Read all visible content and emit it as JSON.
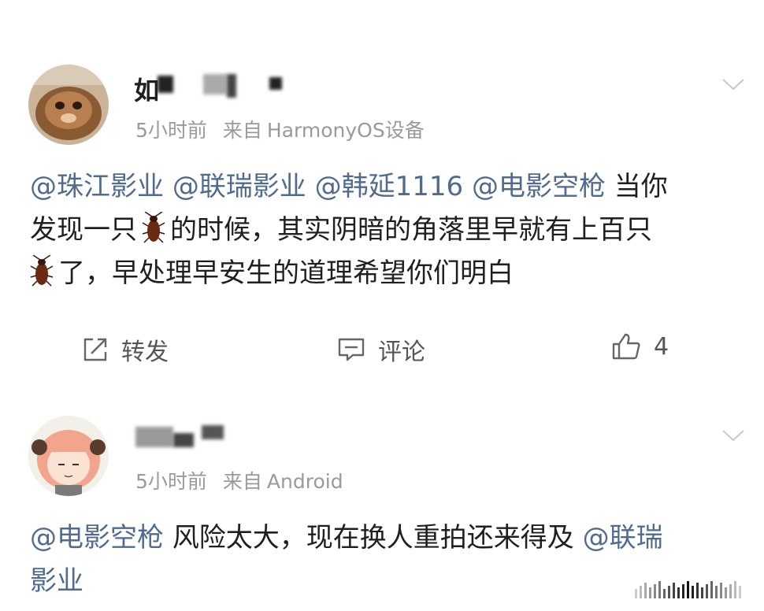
{
  "posts": [
    {
      "username_partial": "如",
      "time": "5小时前",
      "source_prefix": "来自",
      "source": "HarmonyOS设备",
      "mentions": [
        "@珠江影业",
        "@联瑞影业",
        "@韩延1116",
        "@电影空枪"
      ],
      "text_1": "当你",
      "text_2": "发现一只",
      "text_3": "的时候，其实阴暗的角落里早就有上百只",
      "text_4": "了，早处理早安生的道理希望你们明白",
      "actions": {
        "repost": "转发",
        "comment": "评论",
        "like_count": "4"
      }
    },
    {
      "time": "5小时前",
      "source_prefix": "来自",
      "source": "Android",
      "mention_1": "@电影空枪",
      "text_1": "风险太大，现在换人重拍还来得及",
      "mention_2": "@联瑞",
      "mention_2_cont": "影业"
    }
  ],
  "colors": {
    "mention": "#506b8e",
    "meta": "#9a9a9a",
    "text": "#1f1f1f"
  },
  "icons": [
    "chevron-down-icon",
    "cockroach-icon",
    "share-icon",
    "comment-icon",
    "like-icon"
  ]
}
